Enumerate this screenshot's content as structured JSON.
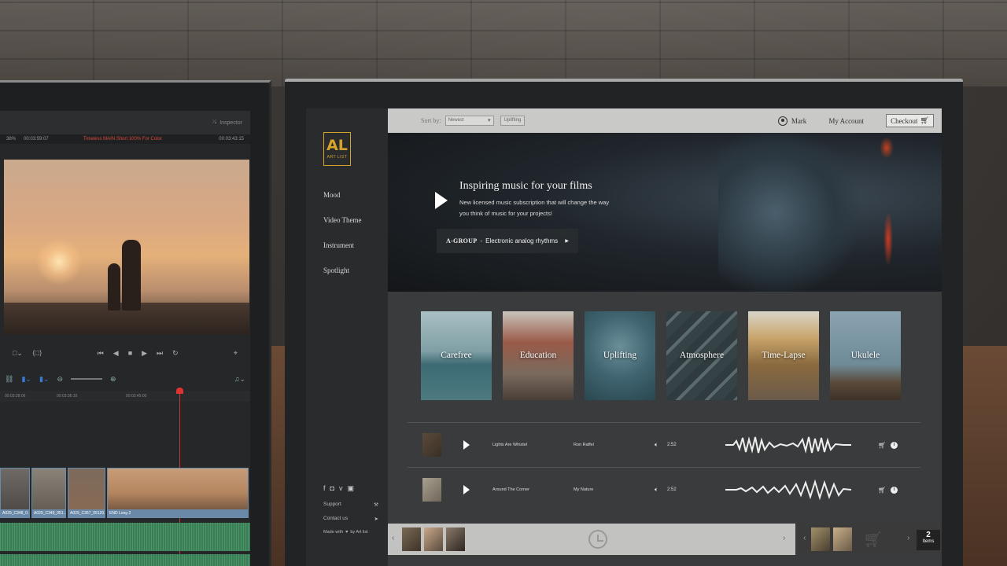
{
  "editor": {
    "inspector": "Inspector",
    "zoom": "38%",
    "timecode_left": "00:03:59:07",
    "clip_title": "Timeless MAIN Short 100% For Color",
    "timecode_right": "00:03:43:15",
    "ruler": [
      "00:03:28:06",
      "00:03:36:16",
      "00:03:45:00"
    ],
    "clips": [
      "A029_C348_0...",
      "A029_C349_051...",
      "A029_C357_05120...",
      "END Long 2"
    ]
  },
  "site": {
    "brand": {
      "logo": "AL",
      "logo_sub": "ART LIST"
    },
    "nav": [
      "Mood",
      "Video Theme",
      "Instrument",
      "Spotlight"
    ],
    "social_icons": [
      "f",
      "instagram-icon",
      "v",
      "youtube-icon"
    ],
    "support": "Support",
    "contact": "Contact us",
    "made_with": "Made with",
    "by": "by Art list",
    "sort_label": "Sort by:",
    "sort_value": "Newest",
    "filter_chip": "Uplifting",
    "user_name": "Mark",
    "my_account": "My Account",
    "checkout": "Checkout",
    "hero": {
      "title": "Inspiring music for your films",
      "subtitle": "New licensed music subscription that will change the way you think of music for your projects!",
      "group_name": "A-GROUP",
      "group_sep": "-",
      "group_desc": "Electronic analog rhythms"
    },
    "categories": [
      "Carefree",
      "Education",
      "Uplifting",
      "Atmosphere",
      "Time-Lapse",
      "Ukulele"
    ],
    "tracks": [
      {
        "title": "Lights Are Whistel",
        "artist": "Ron Raffel",
        "duration": "2:52"
      },
      {
        "title": "Around The Corner",
        "artist": "My Nature",
        "duration": "2:52"
      }
    ],
    "cart_count": "2",
    "cart_label": "Items"
  }
}
